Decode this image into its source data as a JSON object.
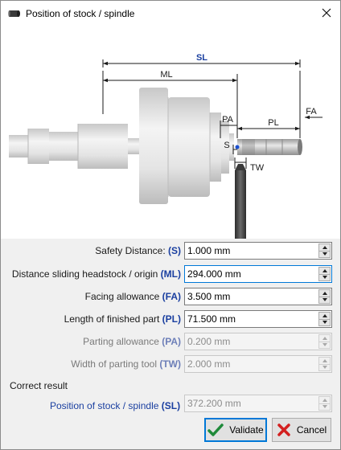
{
  "window": {
    "title": "Position of stock / spindle",
    "close_icon": "close-icon",
    "title_icon": "stock-bar-icon"
  },
  "diagram": {
    "labels": {
      "sl": "SL",
      "ml": "ML",
      "pa": "PA",
      "pl": "PL",
      "fa": "FA",
      "s": "S",
      "tw": "TW"
    },
    "colors": {
      "dimension_line": "#1a1a1a",
      "spindle": "#dedede",
      "stock": "#c9c9c9",
      "tool": "#4a4a4a"
    }
  },
  "form": {
    "rows": [
      {
        "label": "Safety Distance: ",
        "code": "(S)",
        "value": "1.000 mm",
        "enabled": true,
        "focused": false
      },
      {
        "label": "Distance sliding headstock / origin ",
        "code": "(ML)",
        "value": "294.000 mm",
        "enabled": true,
        "focused": true
      },
      {
        "label": "Facing allowance ",
        "code": "(FA)",
        "value": "3.500 mm",
        "enabled": true,
        "focused": false
      },
      {
        "label": "Length of finished part ",
        "code": "(PL)",
        "value": "71.500 mm",
        "enabled": true,
        "focused": false
      },
      {
        "label": "Parting allowance ",
        "code": "(PA)",
        "value": "0.200 mm",
        "enabled": false,
        "focused": false
      },
      {
        "label": "Width of parting tool ",
        "code": "(TW)",
        "value": "2.000 mm",
        "enabled": false,
        "focused": false
      }
    ]
  },
  "result": {
    "section_title": "Correct result",
    "label": "Position of stock / spindle ",
    "code": "(SL)",
    "value": "372.200 mm"
  },
  "buttons": {
    "validate": {
      "label": "Validate",
      "icon": "check-icon",
      "color": "#1f8a3a"
    },
    "cancel": {
      "label": "Cancel",
      "icon": "cross-icon",
      "color": "#d32020"
    }
  }
}
